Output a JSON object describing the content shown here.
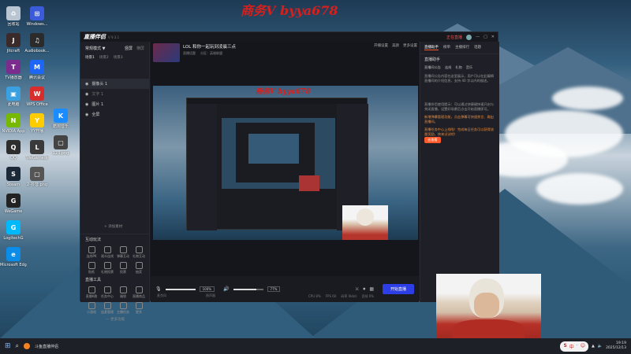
{
  "watermark": {
    "text": "商务V byya678"
  },
  "desktop": {
    "icons": [
      {
        "label": "回收站",
        "color": "#b9c6d2",
        "glyph": "♻"
      },
      {
        "label": "Jitcraft",
        "color": "#3a2a2a",
        "glyph": "J"
      },
      {
        "label": "Windows...",
        "color": "#3b5bdb",
        "glyph": "⊞"
      },
      {
        "label": "TV播放器",
        "color": "#7b2d8e",
        "glyph": "T"
      },
      {
        "label": "Audiobook...",
        "color": "#2b2b2b",
        "glyph": "♫"
      },
      {
        "label": "此电脑",
        "color": "#3aa0e0",
        "glyph": "▣"
      },
      {
        "label": "NVIDIA App",
        "color": "#76b900",
        "glyph": "N"
      },
      {
        "label": "腾讯会议",
        "color": "#1e66f5",
        "glyph": "M"
      },
      {
        "label": "酷狗音乐",
        "color": "#1a8cff",
        "glyph": "K"
      },
      {
        "label": "QQ",
        "color": "#2d2d2d",
        "glyph": "Q"
      },
      {
        "label": "WPS Office",
        "color": "#d72d2d",
        "glyph": "W"
      },
      {
        "label": "Steam",
        "color": "#1b2838",
        "glyph": "S"
      },
      {
        "label": "YY开播",
        "color": "#ffcc00",
        "glyph": "Y"
      },
      {
        "label": "WeGame",
        "color": "#222",
        "glyph": "G"
      },
      {
        "label": "WeGame版",
        "color": "#3a3a3a",
        "glyph": "L"
      },
      {
        "label": "LogitechG",
        "color": "#00b8fc",
        "glyph": "G"
      },
      {
        "label": "2-抖音.png",
        "color": "#555",
        "glyph": "▢"
      },
      {
        "label": "123.png",
        "color": "#444",
        "glyph": "▢"
      },
      {
        "label": "Microsoft Edge",
        "color": "#0c8ce9",
        "glyph": "e"
      }
    ]
  },
  "app": {
    "logo": "直播伴侣",
    "version": "V 9.3.1",
    "titlebar": {
      "rec_badge": "正在直播",
      "items": [
        "—",
        "□",
        "✕"
      ]
    },
    "left": {
      "mode_label": "常规模式 ▼",
      "tabs": [
        "竖屏",
        "横屏"
      ],
      "scene_tabs": [
        "场景1",
        "场景2",
        "场景3"
      ],
      "scenes": [
        "摄像头 1",
        "文字 1",
        "图片 1",
        "全屏"
      ],
      "add_material": "+ 添加素材",
      "interaction_title": "互动玩法",
      "interaction_tools": [
        "连线PK",
        "观众连线",
        "弹幕互动",
        "礼物互动",
        "贴纸",
        "礼物投票",
        "投票",
        "抽奖"
      ],
      "anchor_tools_title": "直播工具",
      "anchor_tools": [
        "直播K歌",
        "任务中心",
        "福袋",
        "直播商品",
        "小游戏",
        "连麦管理",
        "主播任务",
        "更多"
      ],
      "more_label": "— 更多功能"
    },
    "center": {
      "stream_title": "LOL 和你一起玩到凌晨三点",
      "stream_sub_1": "直播话题",
      "stream_sub_2": "分区：英雄联盟",
      "top_right_items": [
        "开播设置",
        "美颜",
        "更多设置"
      ],
      "volume_mic": "100%",
      "volume_speaker": "77%",
      "mic_label": "麦克风",
      "speaker_label": "扬声器",
      "start_button": "开始直播",
      "status": [
        "CPU 8%",
        "FPS 60",
        "码率 0kb/s",
        "丢帧 0%"
      ]
    },
    "right": {
      "tabs": [
        "直播助手",
        "榜单",
        "主播排行",
        "话题"
      ],
      "title": "直播助手",
      "cards": [
        "直播间公告",
        "连线",
        "礼物",
        "音乐"
      ],
      "body_1": "直播间公告内容在这里展示，用户可以在此编辑直播间的介绍信息，支持 40 字以内的描述。",
      "body_2": "直播伴侣使用提示：可以通过快捷键快速开启与关闭直播，设置好场景后点击开始直播即可。",
      "highlight": "新增弹幕管理功能，点击弹幕可快速禁言、踢出直播间。",
      "notice": "直播任务中心上线啦！完成每日任务可以获得流量奖励，快来试试吧！",
      "button": "去查看"
    }
  },
  "taskbar": {
    "app_label": "斗鱼直播伴侣",
    "ime": [
      "S",
      "中",
      "·",
      "☺"
    ],
    "time": "19:19",
    "date": "2025/12/13"
  }
}
